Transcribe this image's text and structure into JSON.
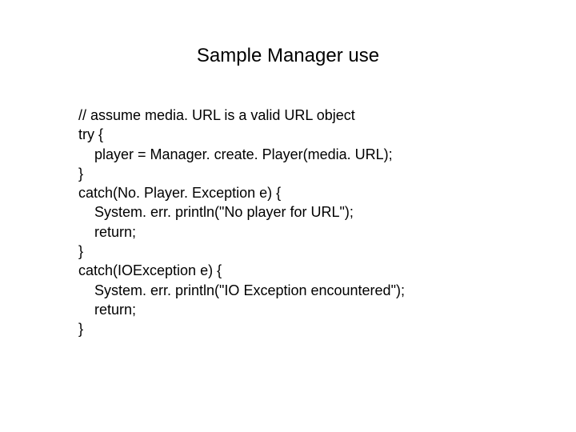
{
  "slide": {
    "title": "Sample Manager use",
    "code": {
      "line1": "// assume media. URL is a valid URL object",
      "line2": "try {",
      "line3": "    player = Manager. create. Player(media. URL);",
      "line4": "}",
      "line5": "catch(No. Player. Exception e) {",
      "line6": "    System. err. println(\"No player for URL\");",
      "line7": "    return;",
      "line8": "}",
      "line9": "catch(IOException e) {",
      "line10": "    System. err. println(\"IO Exception encountered\");",
      "line11": "    return;",
      "line12": "}"
    }
  }
}
